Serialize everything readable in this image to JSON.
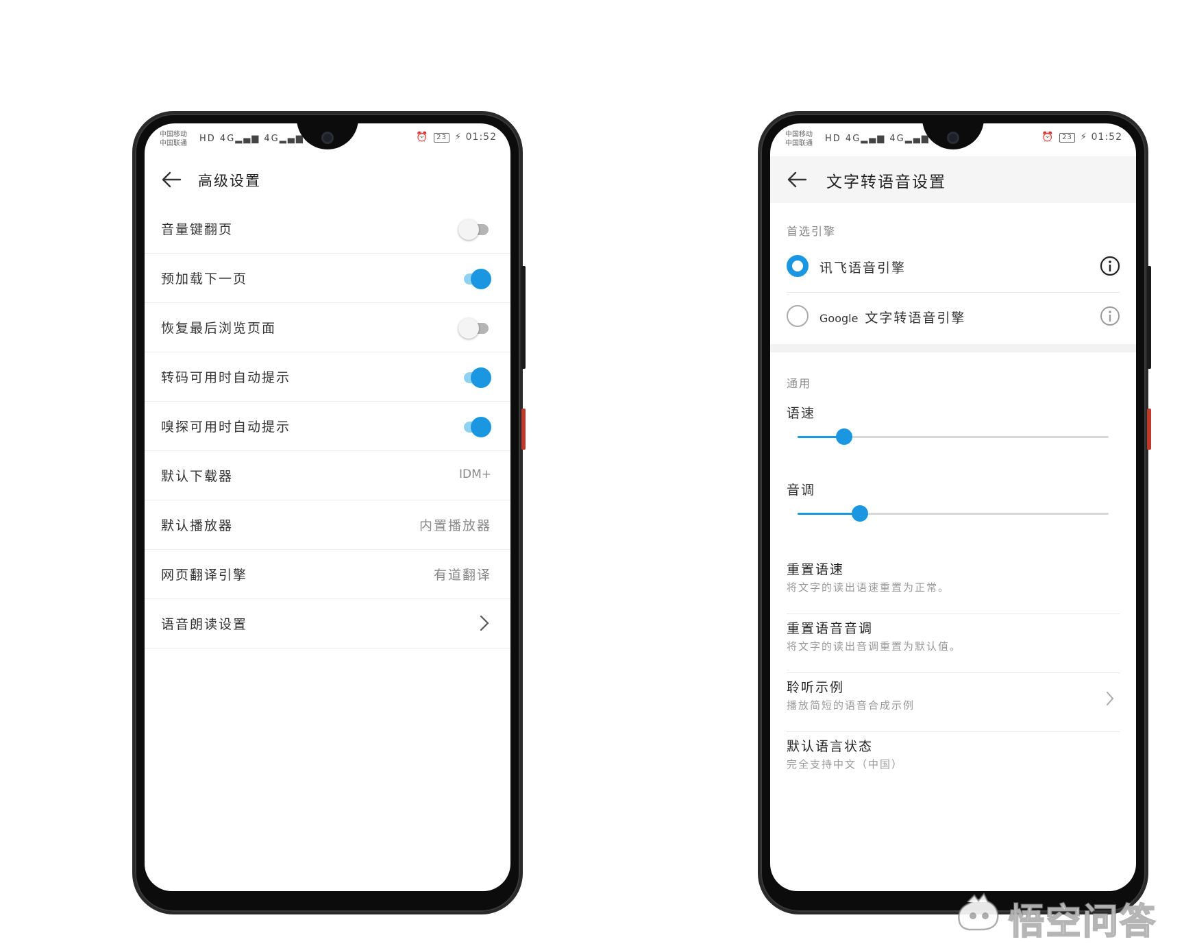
{
  "status_bar": {
    "carrier_1": "中国移动",
    "carrier_2": "中国联通",
    "signal_icons": "HD 4G▂▄▆ 4G▂▄▆ ᯤ",
    "battery": "23",
    "time": "01:52"
  },
  "left_phone": {
    "title": "高级设置",
    "rows": [
      {
        "label": "音量键翻页",
        "type": "toggle",
        "on": false
      },
      {
        "label": "预加载下一页",
        "type": "toggle",
        "on": true
      },
      {
        "label": "恢复最后浏览页面",
        "type": "toggle",
        "on": false
      },
      {
        "label": "转码可用时自动提示",
        "type": "toggle",
        "on": true
      },
      {
        "label": "嗅探可用时自动提示",
        "type": "toggle",
        "on": true
      },
      {
        "label": "默认下载器",
        "type": "value",
        "value": "IDM+"
      },
      {
        "label": "默认播放器",
        "type": "value",
        "value": "内置播放器"
      },
      {
        "label": "网页翻译引擎",
        "type": "value",
        "value": "有道翻译"
      },
      {
        "label": "语音朗读设置",
        "type": "chevron"
      }
    ]
  },
  "right_phone": {
    "title": "文字转语音设置",
    "engine_section": "首选引擎",
    "engines": [
      {
        "name_en": "",
        "name": "讯飞语音引擎",
        "selected": true
      },
      {
        "name_en": "Google",
        "name": "文字转语音引擎",
        "selected": false
      }
    ],
    "general_section": "通用",
    "speed": {
      "label": "语速",
      "level": 0.15
    },
    "pitch": {
      "label": "音调",
      "level": 0.2
    },
    "items": [
      {
        "title": "重置语速",
        "subtitle": "将文字的读出语速重置为正常。",
        "chevron": false
      },
      {
        "title": "重置语音音调",
        "subtitle": "将文字的读出音调重置为默认值。",
        "chevron": false
      },
      {
        "title": "聆听示例",
        "subtitle": "播放简短的语音合成示例",
        "chevron": true
      },
      {
        "title": "默认语言状态",
        "subtitle": "完全支持中文（中国）",
        "chevron": false
      }
    ]
  },
  "watermark": {
    "text": "悟空问答"
  },
  "colors": {
    "accent": "#1a97e0",
    "accent_light": "#8fd2f2"
  }
}
